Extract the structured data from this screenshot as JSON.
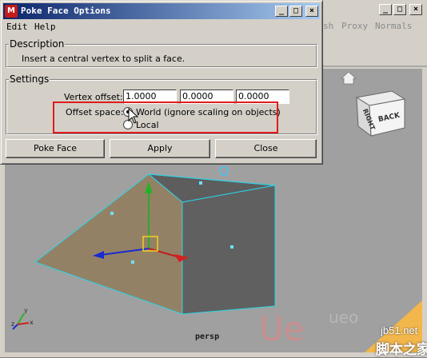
{
  "maya": {
    "menu": [
      {
        "label": "sh"
      },
      {
        "label": "Proxy"
      },
      {
        "label": "Normals"
      }
    ],
    "window_buttons": {
      "minimize": "_",
      "maximize": "□",
      "close": "×"
    },
    "viewport": {
      "camera_label": "persp",
      "viewcube": {
        "front_face": "BACK",
        "side_face": "RIGHT"
      },
      "axis_labels": {
        "x": "x",
        "y": "y",
        "z": "z"
      }
    },
    "watermark": {
      "site": "jb51.net",
      "site_cn": "脚本之家",
      "logo_text": "Ue",
      "logo_text_2": "ueo"
    }
  },
  "dialog": {
    "title": "Poke Face Options",
    "app_icon": "maya-icon",
    "window_buttons": {
      "minimize": "_",
      "maximize": "□",
      "close": "×"
    },
    "menu": [
      {
        "label": "Edit"
      },
      {
        "label": "Help"
      }
    ],
    "description": {
      "title": "Description",
      "text": "Insert a central vertex to split a face."
    },
    "settings": {
      "title": "Settings",
      "vertex_offset_label": "Vertex offset:",
      "vertex_offset": [
        "1.0000",
        "0.0000",
        "0.0000"
      ],
      "offset_space_label": "Offset space:",
      "options": [
        {
          "label": "World (ignore scaling on objects)",
          "selected": true
        },
        {
          "label": "Local",
          "selected": false
        }
      ]
    },
    "buttons": {
      "poke_face": "Poke Face",
      "apply": "Apply",
      "close": "Close"
    },
    "highlight_color": "#e01b1b"
  }
}
